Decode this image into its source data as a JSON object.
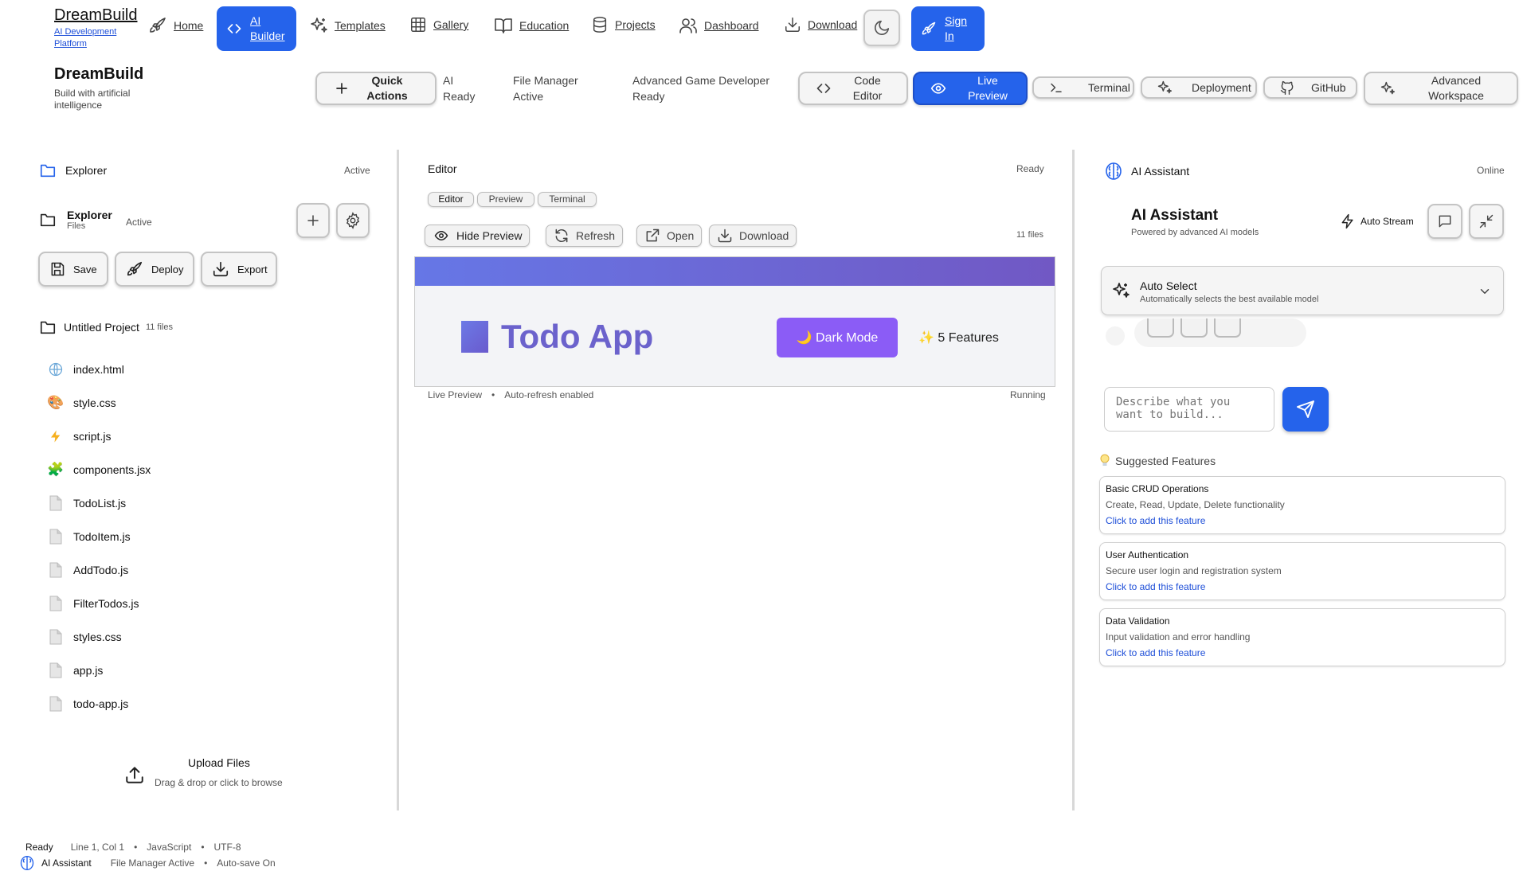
{
  "nav": {
    "brand": "DreamBuild",
    "brand_sub": "AI Development Platform",
    "items": [
      {
        "label": "Home",
        "icon": "rocket-icon"
      },
      {
        "label": "AI Builder",
        "icon": "code-icon"
      },
      {
        "label": "Templates",
        "icon": "sparkles-icon"
      },
      {
        "label": "Gallery",
        "icon": "grid-icon"
      },
      {
        "label": "Education",
        "icon": "book-icon"
      },
      {
        "label": "Projects",
        "icon": "database-icon"
      },
      {
        "label": "Dashboard",
        "icon": "users-icon"
      },
      {
        "label": "Download",
        "icon": "download-icon"
      }
    ],
    "theme_icon": "moon-icon",
    "signin": "Sign In"
  },
  "header": {
    "title": "DreamBuild",
    "subtitle": "Build with artificial intelligence",
    "quick_actions": "Quick Actions",
    "status1": [
      "AI",
      "Ready"
    ],
    "status2": [
      "File Manager",
      "Active"
    ],
    "status3": [
      "Advanced Game Developer",
      "Ready"
    ],
    "code_editor": "Code Editor",
    "live_preview": "Live Preview",
    "terminal": "Terminal",
    "deployment": "Deployment",
    "github": "GitHub",
    "advanced_workspace": "Advanced Workspace"
  },
  "explorer": {
    "title": "Explorer",
    "title_status": "Active",
    "sub_title": "Explorer",
    "sub_files": "Files",
    "sub_status": "Active",
    "save": "Save",
    "deploy": "Deploy",
    "export": "Export",
    "project_name": "Untitled Project",
    "project_count": "11 files",
    "files": [
      {
        "name": "index.html",
        "icon": "globe-icon"
      },
      {
        "name": "style.css",
        "icon": "palette-icon"
      },
      {
        "name": "script.js",
        "icon": "lightning-icon"
      },
      {
        "name": "components.jsx",
        "icon": "puzzle-icon"
      },
      {
        "name": "TodoList.js",
        "icon": "file-icon"
      },
      {
        "name": "TodoItem.js",
        "icon": "file-icon"
      },
      {
        "name": "AddTodo.js",
        "icon": "file-icon"
      },
      {
        "name": "FilterTodos.js",
        "icon": "file-icon"
      },
      {
        "name": "styles.css",
        "icon": "file-icon"
      },
      {
        "name": "app.js",
        "icon": "file-icon"
      },
      {
        "name": "todo-app.js",
        "icon": "file-icon"
      }
    ],
    "upload_title": "Upload Files",
    "upload_sub": "Drag & drop or click to browse"
  },
  "editor": {
    "title": "Editor",
    "status": "Ready",
    "tabs": [
      "Editor",
      "Preview",
      "Terminal"
    ],
    "hide_preview": "Hide Preview",
    "refresh": "Refresh",
    "open": "Open",
    "download": "Download",
    "file_count": "11 files",
    "preview_app_title": "Todo App",
    "preview_dark_mode": "🌙 Dark Mode",
    "preview_features": "✨ 5 Features",
    "footer_left": "Live Preview",
    "footer_mid": "Auto-refresh enabled",
    "footer_right": "Running"
  },
  "assistant": {
    "title": "AI Assistant",
    "status": "Online",
    "heading": "AI Assistant",
    "powered": "Powered by advanced AI models",
    "auto_stream": "Auto Stream",
    "model_title": "Auto Select",
    "model_sub": "Automatically selects the best available model",
    "input_placeholder": "Describe what you want to build...",
    "suggested_title": "Suggested Features",
    "features": [
      {
        "title": "Basic CRUD Operations",
        "desc": "Create, Read, Update, Delete functionality",
        "cta": "Click to add this feature"
      },
      {
        "title": "User Authentication",
        "desc": "Secure user login and registration system",
        "cta": "Click to add this feature"
      },
      {
        "title": "Data Validation",
        "desc": "Input validation and error handling",
        "cta": "Click to add this feature"
      }
    ]
  },
  "statusbar": {
    "ready": "Ready",
    "position": "Line 1, Col 1",
    "language": "JavaScript",
    "encoding": "UTF-8",
    "assistant": "AI Assistant",
    "file_manager": "File Manager Active",
    "autosave": "Auto-save On"
  },
  "colors": {
    "accent": "#2563eb",
    "purple": "#8b5cf6"
  }
}
